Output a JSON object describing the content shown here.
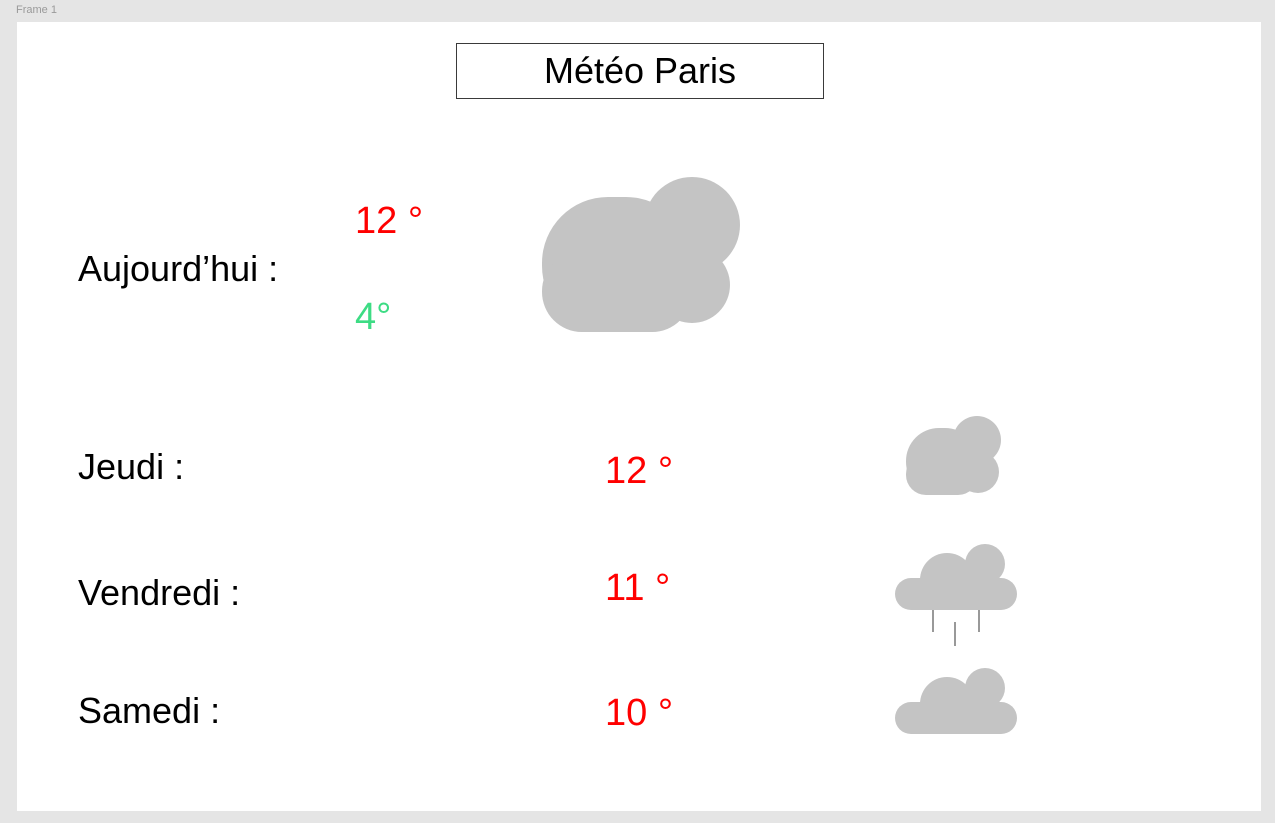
{
  "frame": {
    "label": "Frame 1"
  },
  "header": {
    "title": "Météo Paris"
  },
  "colors": {
    "high": "#ff0000",
    "low": "#3ddc84",
    "cloud": "#c4c4c4",
    "text": "#000000"
  },
  "today": {
    "label": "Aujourd’hui :",
    "high": "12 °",
    "low": "4°",
    "icon": "cloud-icon"
  },
  "forecast": [
    {
      "label": "Jeudi :",
      "temp": "12 °",
      "icon": "cloud-icon"
    },
    {
      "label": "Vendredi :",
      "temp": "11 °",
      "icon": "rain-cloud-icon"
    },
    {
      "label": "Samedi :",
      "temp": "10 °",
      "icon": "cloud-icon"
    }
  ]
}
